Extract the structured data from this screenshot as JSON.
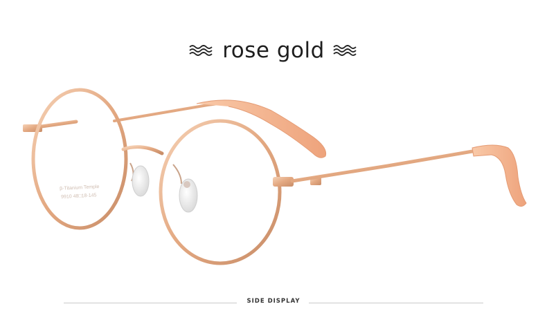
{
  "title": {
    "text": "rose gold",
    "left_ornament": "wave-ornament-icon",
    "right_ornament": "wave-ornament-icon"
  },
  "caption": {
    "text": "SIDE DISPLAY"
  },
  "lens_print": {
    "line1": "β-Titanium Temple",
    "line2": "9910  48□18-145"
  },
  "colors": {
    "frame": "#e8b48f",
    "frame_dark": "#c98f6c",
    "tip": "#f4b793",
    "text": "#1e1e1e"
  }
}
